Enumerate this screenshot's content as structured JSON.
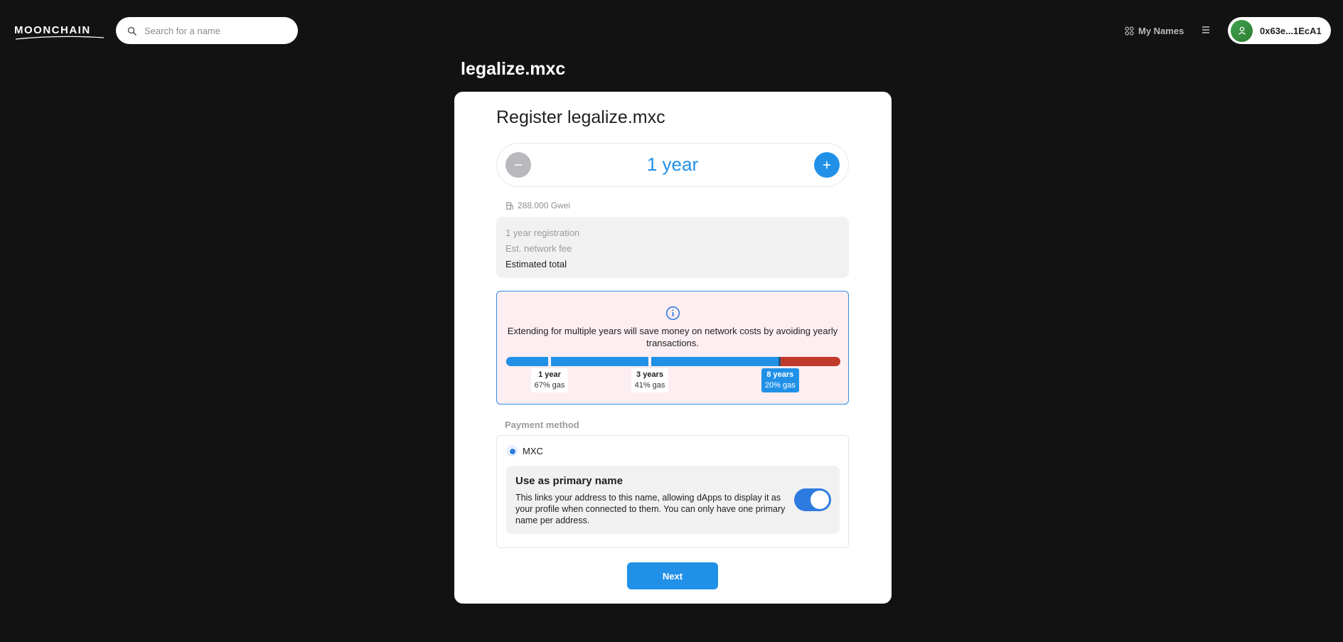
{
  "header": {
    "logo_text": "MOONCHAIN",
    "search": {
      "placeholder": "Search for a name"
    },
    "my_names_label": "My Names",
    "account_label": "0x63e...1EcA1"
  },
  "page": {
    "title": "legalize.mxc"
  },
  "register": {
    "title": "Register legalize.mxc",
    "duration_label": "1 year",
    "gas_price": "288.000 Gwei",
    "fees": {
      "registration_label": "1 year registration",
      "network_fee_label": "Est. network fee",
      "total_label": "Estimated total"
    },
    "info": {
      "text": "Extending for multiple years will save money on network costs by avoiding yearly transactions.",
      "marks": [
        {
          "years": "1 year",
          "gas": "67% gas",
          "position": 0.13,
          "active": false
        },
        {
          "years": "3 years",
          "gas": "41% gas",
          "position": 0.43,
          "active": false
        },
        {
          "years": "8 years",
          "gas": "20% gas",
          "position": 0.82,
          "active": true
        }
      ],
      "colors": {
        "saving": "#2191e8",
        "cost": "#c0392b"
      }
    },
    "payment": {
      "label": "Payment method",
      "option_label": "MXC",
      "selected": true
    },
    "primary_name": {
      "title": "Use as primary name",
      "description": "This links your address to this name, allowing dApps to display it as your profile when connected to them. You can only have one primary name per address.",
      "enabled": true
    },
    "next_label": "Next"
  },
  "colors": {
    "background": "#121212",
    "accent": "#2191e8",
    "card": "#ffffff",
    "info_bg": "#fdeef1"
  }
}
